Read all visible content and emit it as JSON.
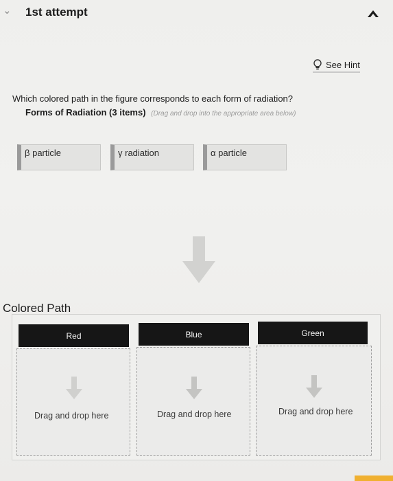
{
  "attempt": {
    "title": "1st attempt",
    "chevron_icon": "chevron-down-icon",
    "collapse_icon": "arrow-up-icon"
  },
  "hint": {
    "label": "See Hint",
    "icon": "lightbulb-icon"
  },
  "question": {
    "text": "Which colored path in the figure corresponds to each form of radiation?",
    "items_heading": "Forms of Radiation (3 items)",
    "instruction": "(Drag and drop into the appropriate area below)"
  },
  "items": [
    {
      "label": "β particle"
    },
    {
      "label": "γ radiation"
    },
    {
      "label": "α particle"
    }
  ],
  "target_section": {
    "label": "Colored Path",
    "columns": [
      {
        "header": "Red",
        "drop_text": "Drag and drop here"
      },
      {
        "header": "Blue",
        "drop_text": "Drag and drop here"
      },
      {
        "header": "Green",
        "drop_text": "Drag and drop here"
      }
    ]
  },
  "colors": {
    "header_bg": "#161616",
    "arrow_gray": "#c9c9c9",
    "accent_tab": "#f0b030"
  }
}
